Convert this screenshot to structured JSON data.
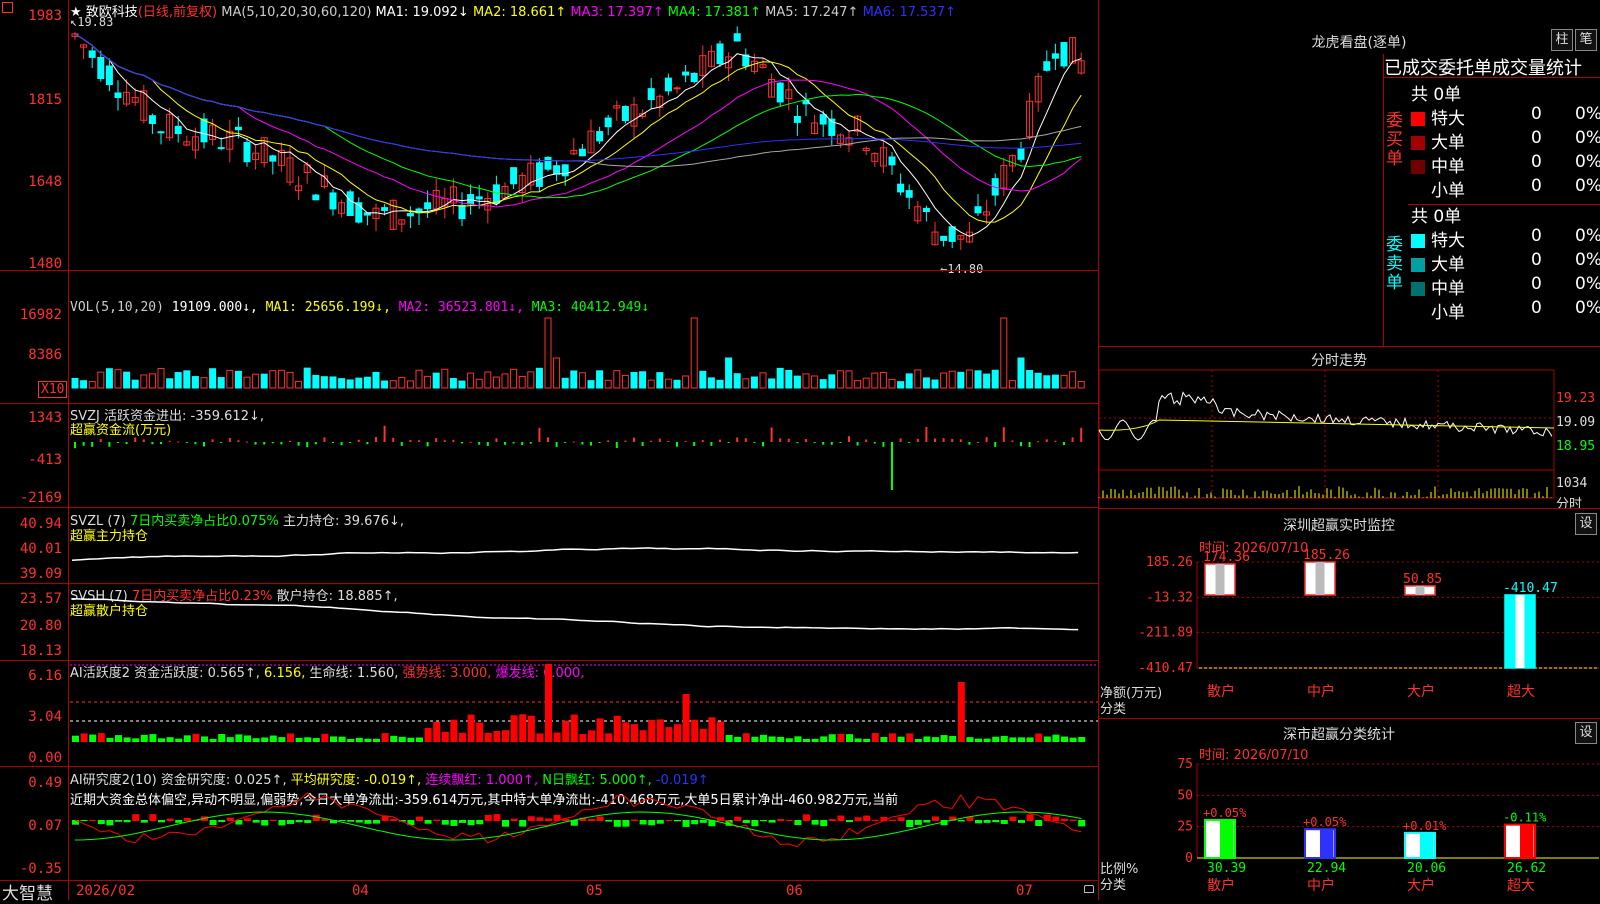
{
  "app": {
    "brand": "大智慧",
    "stock_name": "致欧科技",
    "period": "(日线,前复权)"
  },
  "main": {
    "header": "MA(5,10,20,30,60,120)",
    "ma": [
      {
        "label": "MA1:",
        "value": "19.092↓",
        "color": "#ffffff"
      },
      {
        "label": "MA2:",
        "value": "18.661↑",
        "color": "#ffff00"
      },
      {
        "label": "MA3:",
        "value": "17.397↑",
        "color": "#ff00ff"
      },
      {
        "label": "MA4:",
        "value": "17.381↑",
        "color": "#00ff00"
      },
      {
        "label": "MA5:",
        "value": "17.247↑",
        "color": "#cccccc"
      },
      {
        "label": "MA6:",
        "value": "17.537↑",
        "color": "#3030ff"
      }
    ],
    "y_ticks": [
      "1983",
      "1815",
      "1648",
      "1480"
    ],
    "high_label": "19.83",
    "low_label": "←14.80"
  },
  "vol": {
    "header": "VOL(5,10,20)",
    "value": "19109.000↓,",
    "ma": [
      {
        "label": "MA1:",
        "value": "25656.199↓,",
        "color": "#ffff00"
      },
      {
        "label": "MA2:",
        "value": "36523.801↓,",
        "color": "#ff00ff"
      },
      {
        "label": "MA3:",
        "value": "40412.949↓",
        "color": "#00ff00"
      }
    ],
    "y_ticks": [
      "16982",
      "8386"
    ],
    "unit": "X10"
  },
  "svzj": {
    "line1": "SVZJ  活跃资金进出: -359.612↓,",
    "line2": "超赢资金流(万元)",
    "y_ticks": [
      "1343",
      "-413",
      "-2169"
    ]
  },
  "svzl": {
    "name": "SVZL (7)",
    "desc": "7日内买卖净占比0.075%",
    "hold": "主力持仓: 39.676↓,",
    "line2": "超赢主力持仓",
    "y_ticks": [
      "40.94",
      "40.01",
      "39.09"
    ]
  },
  "svsh": {
    "name": "SVSH (7)",
    "desc": "7日内买卖净占比0.23%",
    "hold": "散户持仓: 18.885↑,",
    "line2": "超赢散户持仓",
    "y_ticks": [
      "23.57",
      "20.80",
      "18.13"
    ]
  },
  "ai1": {
    "name": "AI活跃度2",
    "t1": "资金活跃度: 0.565↑,",
    "t2": "6.156,",
    "t3": "生命线: 1.560,",
    "t4": "强势线: 3.000,",
    "t5": "爆发线: 6.000,",
    "y_ticks": [
      "6.16",
      "3.04",
      "0.00"
    ]
  },
  "ai2": {
    "name": "AI研究度2(10)",
    "t1": "资金研究度: 0.025↑,",
    "t2": "平均研究度: -0.019↑,",
    "t3": "连续飘红: 1.000↑,",
    "t4": "N日飘红: 5.000↑,",
    "t5": "-0.019↑",
    "comment": "近期大资金总体偏空,异动不明显,偏弱势,今日大单净流出:-359.614万元,其中特大单净流出:-410.468万元,大单5日累计净出-460.982万元,当前",
    "y_ticks": [
      "0.49",
      "0.07",
      "-0.35"
    ]
  },
  "xaxis": [
    "2026/02",
    "04",
    "05",
    "06",
    "07"
  ],
  "longhu": {
    "title": "龙虎看盘(逐单)",
    "btn1": "柱",
    "btn2": "笔",
    "stat_title": "已成交委托单成交量统计",
    "buy_label": "委买单",
    "sell_label": "委卖单",
    "total": "共 0单",
    "buy_rows": [
      {
        "label": "特大",
        "n": "0",
        "p": "0%",
        "color": "#ff0000"
      },
      {
        "label": "大单",
        "n": "0",
        "p": "0%",
        "color": "#a00000"
      },
      {
        "label": "中单",
        "n": "0",
        "p": "0%",
        "color": "#700000"
      },
      {
        "label": "小单",
        "n": "0",
        "p": "0%",
        "color": "#000000"
      }
    ],
    "sell_rows": [
      {
        "label": "特大",
        "n": "0",
        "p": "0%",
        "color": "#00ffff"
      },
      {
        "label": "大单",
        "n": "0",
        "p": "0%",
        "color": "#00a0a0"
      },
      {
        "label": "中单",
        "n": "0",
        "p": "0%",
        "color": "#007070"
      },
      {
        "label": "小单",
        "n": "0",
        "p": "0%",
        "color": "#000000"
      }
    ]
  },
  "fenshi": {
    "title": "分时走势",
    "y_ticks": [
      "19.23",
      "19.09",
      "18.95"
    ],
    "vol_tick": "1034",
    "vol_label": "分时"
  },
  "monitor": {
    "title": "深圳超赢实时监控",
    "btn": "设",
    "time": "时间: 2026/07/10",
    "y_ticks": [
      "185.26",
      "-13.32",
      "-211.89",
      "-410.47"
    ],
    "y_label1": "净额(万元)",
    "y_label2": "分类",
    "bars": [
      {
        "cat": "散户",
        "value": 174.36,
        "label": "174.36"
      },
      {
        "cat": "中户",
        "value": 185.26,
        "label": "185.26"
      },
      {
        "cat": "大户",
        "value": 50.85,
        "label": "50.85"
      },
      {
        "cat": "超大",
        "value": -410.47,
        "label": "-410.47"
      }
    ]
  },
  "classify": {
    "title": "深市超赢分类统计",
    "btn": "设",
    "time": "时间: 2026/07/10",
    "y_ticks": [
      "75",
      "50",
      "25",
      "0"
    ],
    "y_label1": "比例%",
    "y_label2": "分类",
    "bars": [
      {
        "cat": "散户",
        "value": 30.39,
        "label": "30.39",
        "delta": "+0.05%",
        "color": "#00ff00"
      },
      {
        "cat": "中户",
        "value": 22.94,
        "label": "22.94",
        "delta": "+0.05%",
        "color": "#3030ff"
      },
      {
        "cat": "大户",
        "value": 20.06,
        "label": "20.06",
        "delta": "+0.01%",
        "color": "#00ffff"
      },
      {
        "cat": "超大",
        "value": 26.62,
        "label": "26.62",
        "delta": "-0.11%",
        "color": "#ff0000"
      }
    ]
  },
  "chart_data": {
    "type": "bar",
    "title": "深圳超赢实时监控",
    "categories": [
      "散户",
      "中户",
      "大户",
      "超大"
    ],
    "values": [
      174.36,
      185.26,
      50.85,
      -410.47
    ],
    "ylabel": "净额(万元)",
    "ylim": [
      -410.47,
      185.26
    ]
  }
}
